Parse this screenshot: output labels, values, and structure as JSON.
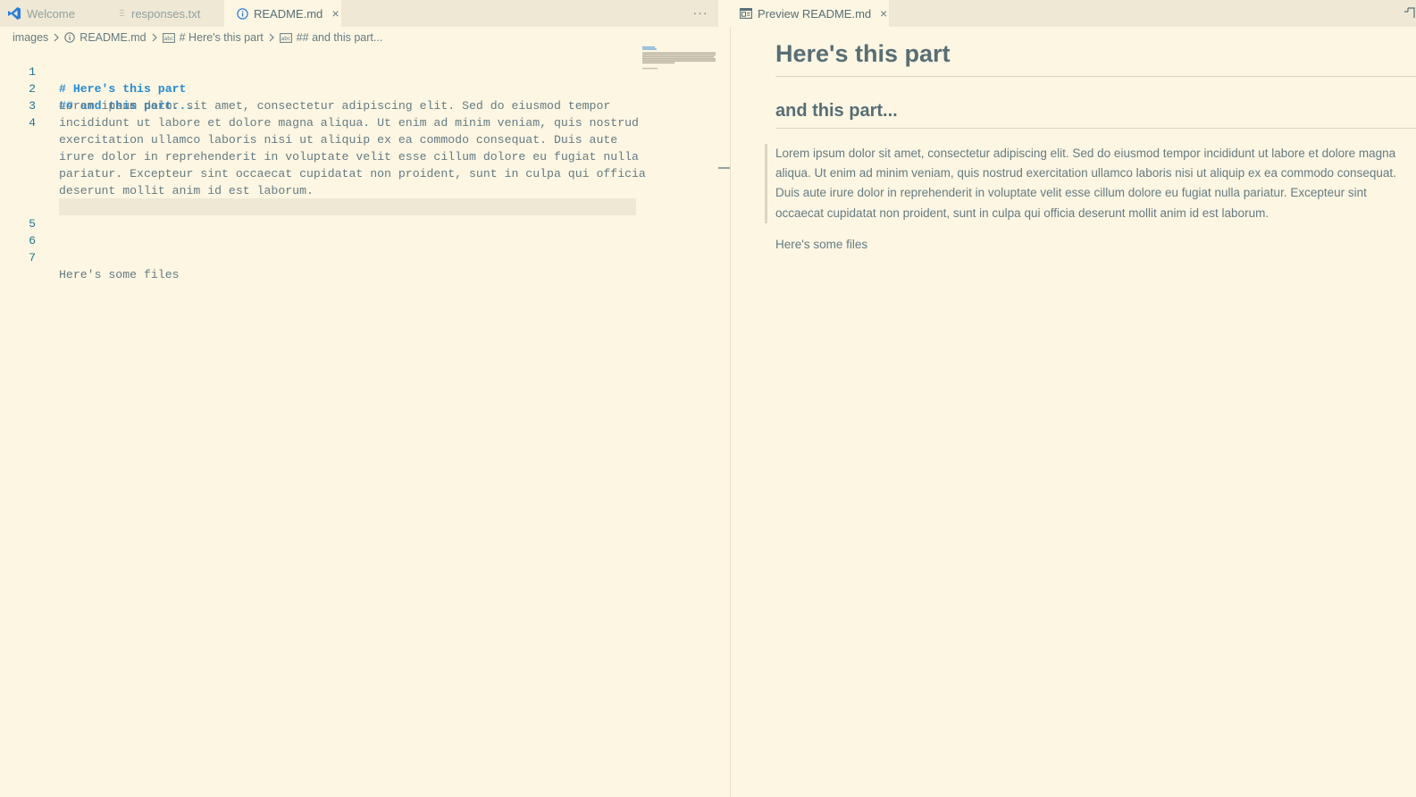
{
  "left_group": {
    "tabs": [
      {
        "label": "Welcome",
        "icon": "vscode-logo-icon"
      },
      {
        "label": "responses.txt",
        "icon": "text-file-icon"
      },
      {
        "label": "README.md",
        "icon": "info-icon",
        "close": "×"
      }
    ],
    "more_actions": "···",
    "breadcrumb": [
      {
        "label": "images"
      },
      {
        "label": "README.md",
        "icon": "info-icon"
      },
      {
        "label": "# Here's this part",
        "icon": "abc-symbol-icon"
      },
      {
        "label": "## and this part...",
        "icon": "abc-symbol-icon"
      }
    ],
    "editor": {
      "lines": [
        {
          "num": "1",
          "text": "# Here's this part",
          "heading": true
        },
        {
          "num": "2",
          "text": "## and this part...",
          "heading": true
        },
        {
          "num": "3",
          "text": ""
        },
        {
          "num": "4",
          "wrapped": [
            "Lorem ipsum dolor sit amet, consectetur adipiscing elit. Sed do eiusmod tempor",
            "incididunt ut labore et dolore magna aliqua. Ut enim ad minim veniam, quis nostrud",
            "exercitation ullamco laboris nisi ut aliquip ex ea commodo consequat. Duis aute",
            "irure dolor in reprehenderit in voluptate velit esse cillum dolore eu fugiat nulla",
            "pariatur. Excepteur sint occaecat cupidatat non proident, sunt in culpa qui officia",
            "deserunt mollit anim id est laborum."
          ]
        },
        {
          "num": "5",
          "text": ""
        },
        {
          "num": "6",
          "text": ""
        },
        {
          "num": "7",
          "text": "Here's some files"
        }
      ]
    }
  },
  "right_group": {
    "tab": {
      "label": "Preview README.md",
      "icon": "preview-icon",
      "close": "×"
    },
    "preview": {
      "h1": "Here's this part",
      "h2": "and this part...",
      "blockquote": "Lorem ipsum dolor sit amet, consectetur adipiscing elit. Sed do eiusmod tempor incididunt ut labore et dolore magna aliqua. Ut enim ad minim veniam, quis nostrud exercitation ullamco laboris nisi ut aliquip ex ea commodo consequat. Duis aute irure dolor in reprehenderit in voluptate velit esse cillum dolore eu fugiat nulla pariatur. Excepteur sint occaecat cupidatat non proident, sunt in culpa qui officia deserunt mollit anim id est laborum.",
      "paragraph": "Here's some files"
    }
  },
  "colors": {
    "background": "#fdf6e3",
    "tabbar": "#eee8d5",
    "heading_syntax": "#268bd2",
    "line_number": "#237893",
    "text": "#657b83"
  }
}
